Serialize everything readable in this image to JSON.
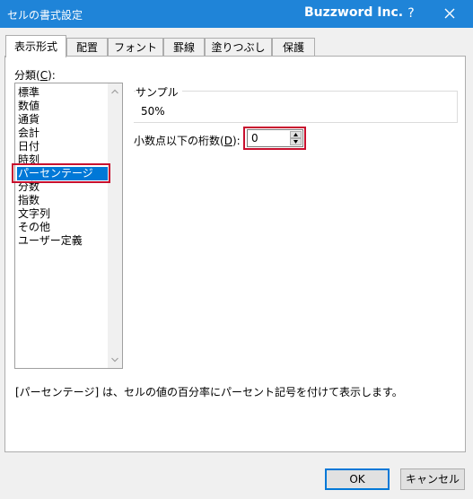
{
  "window": {
    "title": "セルの書式設定",
    "brand": "Buzzword Inc.",
    "help_label": "?"
  },
  "tabs": [
    {
      "label": "表示形式",
      "active": true
    },
    {
      "label": "配置"
    },
    {
      "label": "フォント"
    },
    {
      "label": "罫線"
    },
    {
      "label": "塗りつぶし"
    },
    {
      "label": "保護"
    }
  ],
  "category": {
    "label_prefix": "分類(",
    "label_key": "C",
    "label_suffix": "):",
    "items": [
      "標準",
      "数値",
      "通貨",
      "会計",
      "日付",
      "時刻",
      "パーセンテージ",
      "分数",
      "指数",
      "文字列",
      "その他",
      "ユーザー定義"
    ],
    "selected": "パーセンテージ"
  },
  "sample": {
    "label": "サンプル",
    "value": "50%"
  },
  "decimal": {
    "label_prefix": "小数点以下の桁数(",
    "label_key": "D",
    "label_suffix": "):",
    "value": "0"
  },
  "description": "[パーセンテージ] は、セルの値の百分率にパーセント記号を付けて表示します。",
  "buttons": {
    "ok": "OK",
    "cancel": "キャンセル"
  },
  "colors": {
    "titlebar": "#1f84d8",
    "selection": "#0078d7",
    "highlight_box": "#c8102e"
  }
}
